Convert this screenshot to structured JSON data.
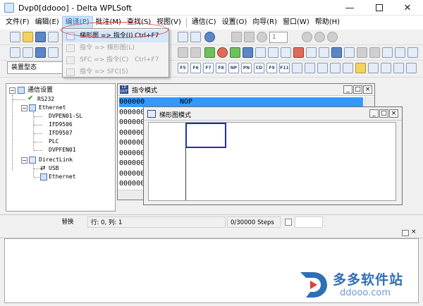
{
  "window": {
    "title": "Dvp0[ddooo] - Delta WPLSoft",
    "controls": [
      "minimize-icon",
      "maximize-icon",
      "close-icon"
    ]
  },
  "menubar": {
    "items": [
      "文件(F)",
      "编辑(E)",
      "编译(P)",
      "批注(M)",
      "查找(S)",
      "视图(V)",
      "通信(C)",
      "设置(O)",
      "向导(R)",
      "窗口(W)",
      "帮助(H)"
    ],
    "active_index": 2
  },
  "compile_menu": {
    "items": [
      {
        "label": "梯形图 => 指令(I)",
        "shortcut": "Ctrl+F7",
        "enabled": true
      },
      {
        "label": "指令 => 梯形图(L)",
        "shortcut": "",
        "enabled": false
      },
      {
        "label": "SFC => 指令(C)",
        "shortcut": "Ctrl+F7",
        "enabled": false
      },
      {
        "label": "指令 => SFC(S)",
        "shortcut": "",
        "enabled": false
      }
    ]
  },
  "toolbar": {
    "spin_value": "1"
  },
  "device_combo": {
    "value": "装置型态"
  },
  "tree": {
    "root": "通信设置",
    "rs232": "RS232",
    "ethernet": "Ethernet",
    "ethernet_children": [
      "DVPEN01-SL",
      "IFD9506",
      "IFD9507",
      "PLC",
      "DVPFEN01"
    ],
    "directlink": "DirectLink",
    "directlink_children": [
      "USB",
      "Ethernet"
    ]
  },
  "instruction_window": {
    "title": "指令模式",
    "rows": [
      {
        "addr": "000000",
        "op": "NOP",
        "selected": true
      },
      {
        "addr": "000000",
        "op": "",
        "selected": false
      },
      {
        "addr": "000000",
        "op": "",
        "selected": false
      },
      {
        "addr": "000000",
        "op": "",
        "selected": false
      },
      {
        "addr": "000000",
        "op": "",
        "selected": false
      },
      {
        "addr": "000000",
        "op": "",
        "selected": false
      },
      {
        "addr": "000000",
        "op": "",
        "selected": false
      },
      {
        "addr": "000000",
        "op": "",
        "selected": false
      },
      {
        "addr": "000000",
        "op": "",
        "selected": false
      }
    ]
  },
  "ladder_window": {
    "title": "梯形图模式"
  },
  "statusbar": {
    "mode": "替换",
    "position": "行: 0, 列: 1",
    "steps": "0/30000 Steps"
  },
  "watermark": {
    "brand": "多多软件站",
    "url": "ddooo.com"
  },
  "colors": {
    "selection": "#3399ff",
    "accent_red": "#e0413a",
    "watermark_blue": "#2f6fb5"
  }
}
